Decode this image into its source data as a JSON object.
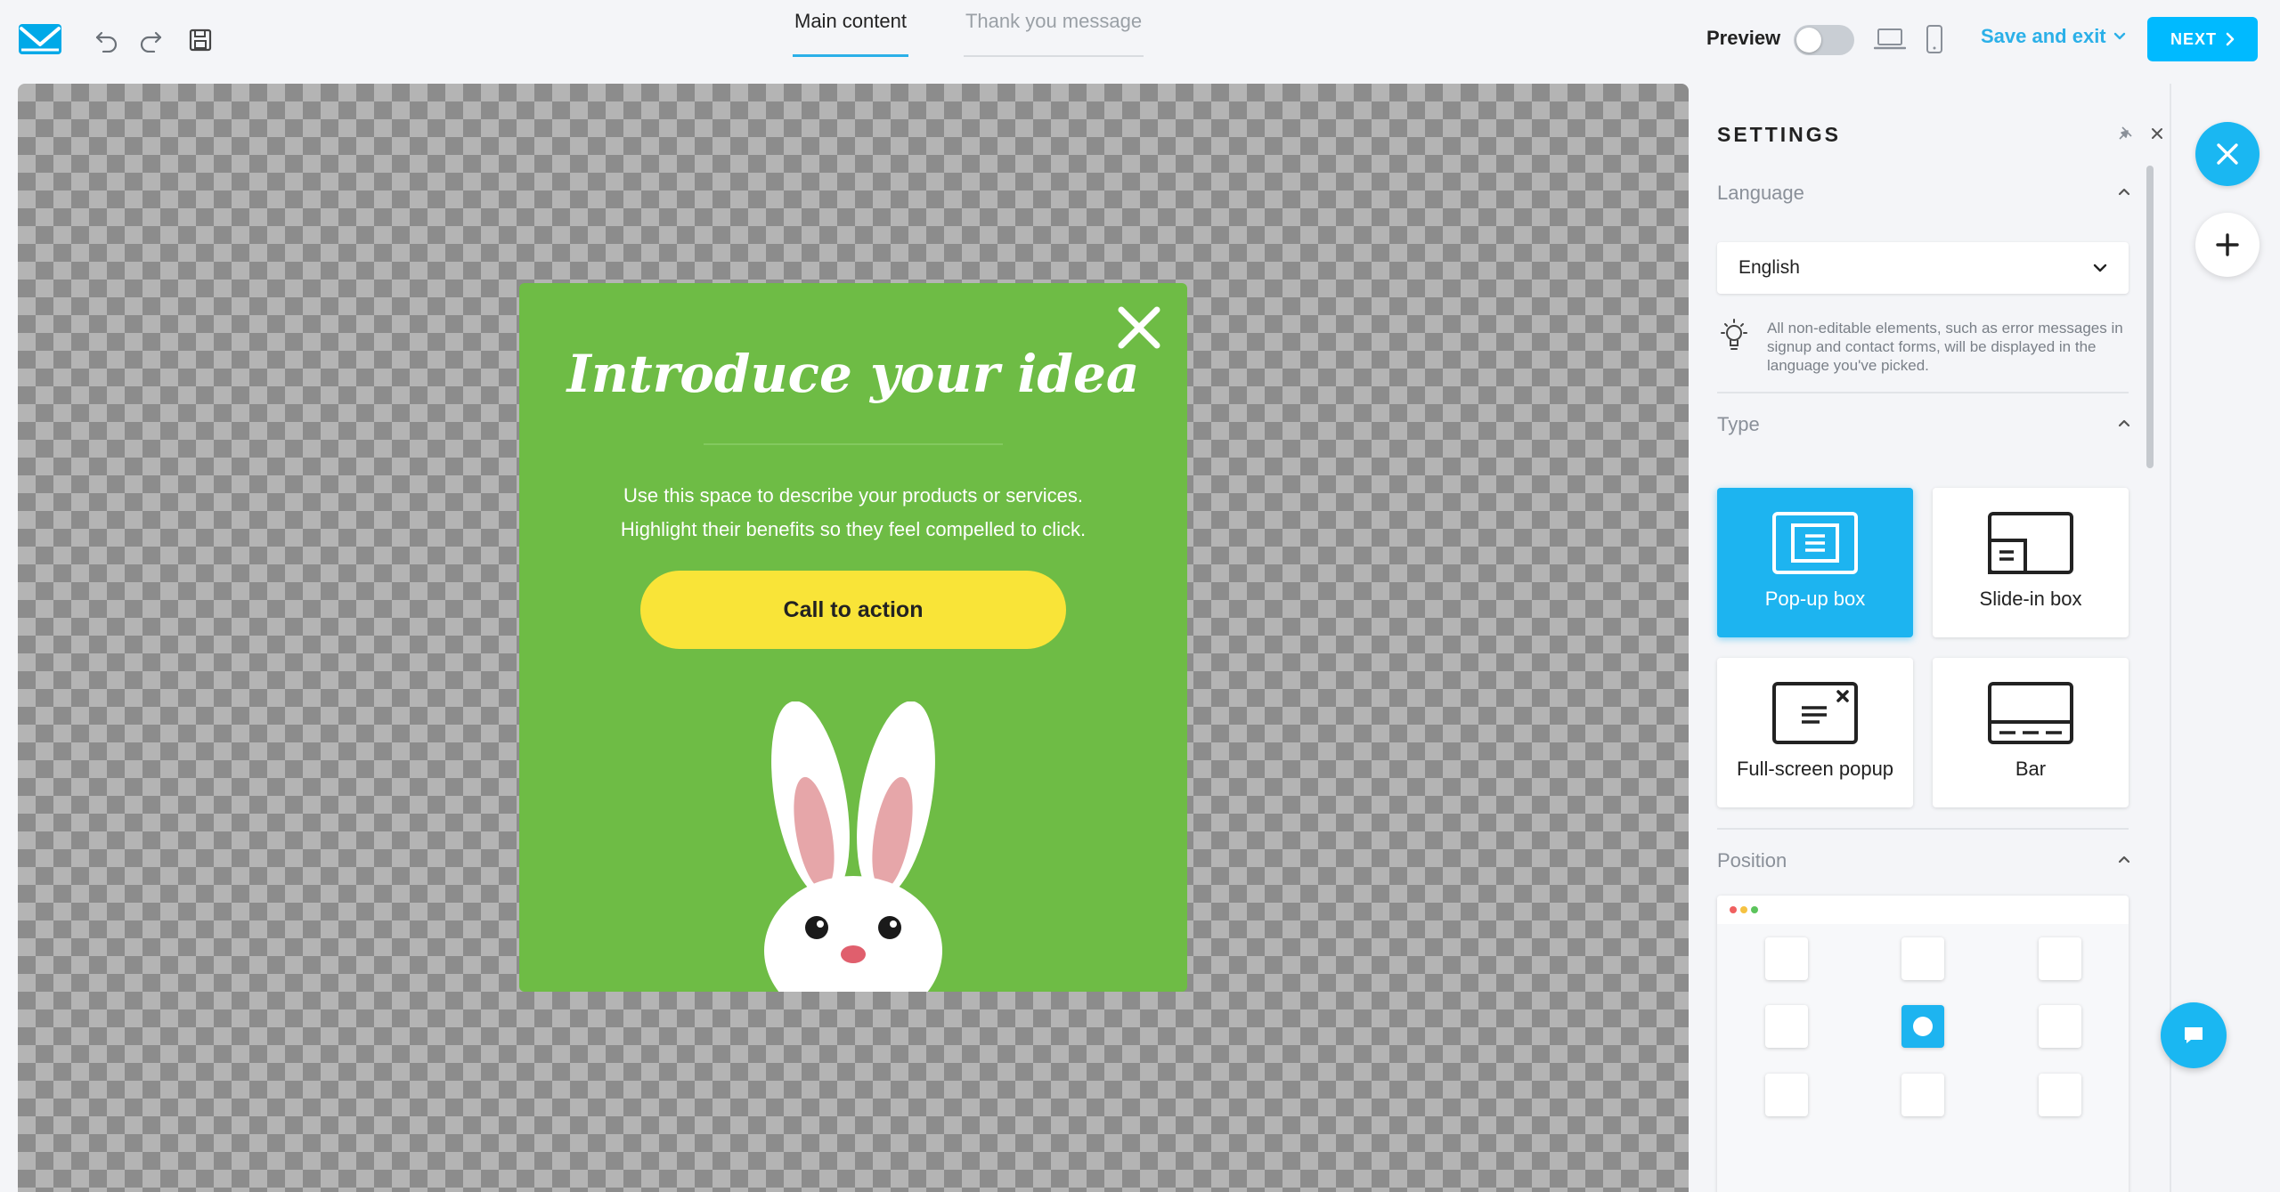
{
  "header": {
    "tabs": [
      {
        "label": "Main content",
        "active": true
      },
      {
        "label": "Thank you message",
        "active": false
      }
    ],
    "preview_label": "Preview",
    "preview_enabled": false,
    "save_exit_label": "Save and exit",
    "next_label": "NEXT"
  },
  "popup": {
    "title": "Introduce your idea",
    "body_line1": "Use this space to describe your products or services.",
    "body_line2": "Highlight their benefits so they feel compelled to click.",
    "cta_label": "Call to action",
    "background_color": "#6ebc45",
    "cta_color": "#f9e438"
  },
  "settings": {
    "title": "SETTINGS",
    "language": {
      "label": "Language",
      "selected": "English",
      "hint": "All non-editable elements, such as error messages in signup and contact forms, will be displayed in the language you've picked."
    },
    "type": {
      "label": "Type",
      "options": [
        {
          "label": "Pop-up box",
          "selected": true
        },
        {
          "label": "Slide-in box",
          "selected": false
        },
        {
          "label": "Full-screen popup",
          "selected": false
        },
        {
          "label": "Bar",
          "selected": false
        }
      ]
    },
    "position": {
      "label": "Position",
      "selected": "middle-center"
    }
  },
  "colors": {
    "accent": "#00baff",
    "selected_card": "#1db4f0"
  }
}
